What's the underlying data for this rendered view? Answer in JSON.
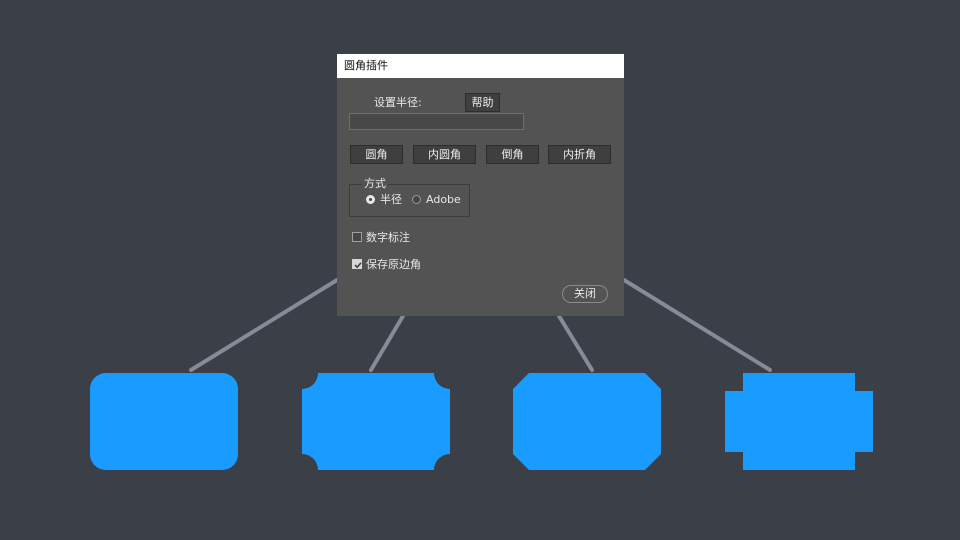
{
  "dialog": {
    "title": "圆角插件",
    "radius_label": "设置半径:",
    "help_label": "帮助",
    "radius_value": "",
    "buttons": {
      "round": "圆角",
      "inner_round": "内圆角",
      "chamfer": "倒角",
      "inner_fold": "内折角"
    },
    "mode": {
      "legend": "方式",
      "options": [
        {
          "label": "半径",
          "selected": true
        },
        {
          "label": "Adobe",
          "selected": false
        }
      ]
    },
    "number_annotation": {
      "label": "数字标注",
      "checked": false
    },
    "keep_original": {
      "label": "保存原边角",
      "checked": true
    },
    "close_label": "关闭"
  },
  "colors": {
    "background": "#3a3f48",
    "dialog": "#535353",
    "shape_fill": "#1a9bff",
    "connector": "#868a99",
    "input_focus": "#2f7bd0"
  }
}
